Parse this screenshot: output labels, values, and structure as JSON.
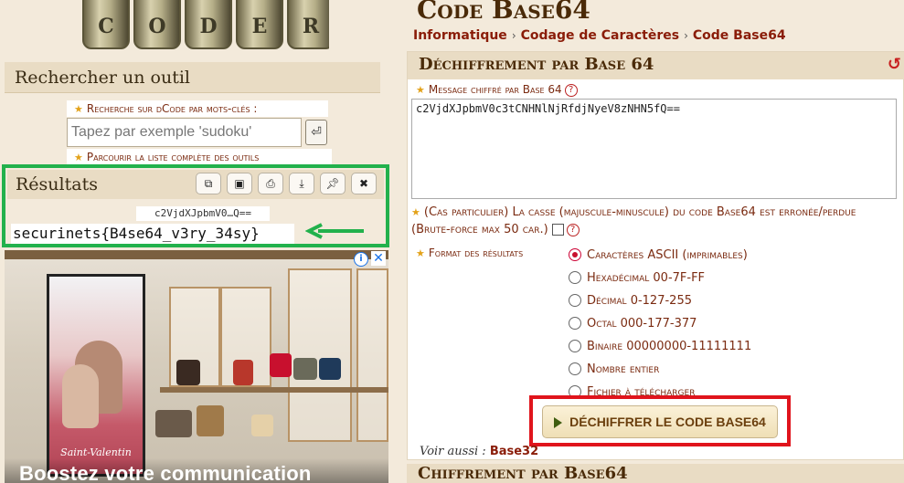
{
  "logo": {
    "cylinder_letters": [
      "C",
      "O",
      "D",
      "E",
      "R"
    ]
  },
  "left": {
    "search_title": "Rechercher un outil",
    "keyword_label": "Recherche sur dCode par mots-clés :",
    "search_placeholder": "Tapez par exemple 'sudoku'",
    "browse_label": "Parcourir la liste complète des outils",
    "results": {
      "title": "Résultats",
      "tools": [
        "copy-icon",
        "screenshot-icon",
        "print-icon",
        "download-icon",
        "pin-icon",
        "close-icon"
      ],
      "input_echo": "c2VjdXJpbmV0…Q==",
      "output": "securinets{B4se64_v3ry_34sy}"
    },
    "ad": {
      "poster_caption": "Saint-Valentin",
      "headline": "Boostez votre communication"
    }
  },
  "right": {
    "page_title": "Code Base64",
    "breadcrumb": [
      "Informatique",
      "Codage de Caractères",
      "Code Base64"
    ],
    "panel": {
      "title": "Déchiffrement par Base 64",
      "message_label": "Message chiffré par Base 64",
      "message_value": "c2VjdXJpbmV0c3tCNHNlNjRfdjNyeV8zNHN5fQ==",
      "case_label": "(Cas particulier) La casse (majuscule-minuscule) du code Base64 est erronée/perdue (Brute-force max 50 car.)",
      "format_label": "Format des résultats",
      "formats": [
        {
          "label": "Caractères ASCII (imprimables)",
          "selected": true
        },
        {
          "label": "Hexadécimal 00-7F-FF",
          "selected": false
        },
        {
          "label": "Décimal 0-127-255",
          "selected": false
        },
        {
          "label": "Octal 000-177-377",
          "selected": false
        },
        {
          "label": "Binaire 00000000-11111111",
          "selected": false
        },
        {
          "label": "Nombre entier",
          "selected": false
        },
        {
          "label": "Fichier à télécharger",
          "selected": false
        }
      ],
      "decode_button": "DÉCHIFFRER LE CODE BASE64",
      "see_also_label": "Voir aussi :",
      "see_also_link": "Base32"
    },
    "panel2_title": "Chiffrement par Base64"
  },
  "colors": {
    "highlight_green": "#22b14c",
    "highlight_red": "#e0141c",
    "accent": "#8a1c08"
  }
}
